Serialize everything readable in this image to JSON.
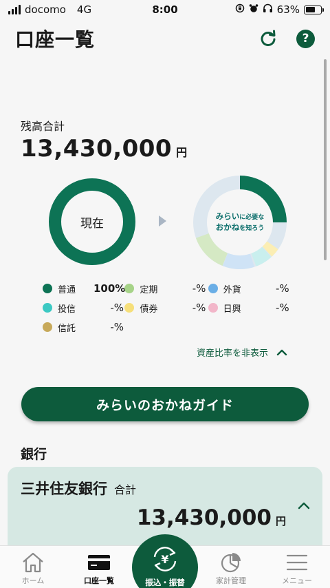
{
  "status_bar": {
    "carrier": "docomo",
    "network": "4G",
    "time": "8:00",
    "battery_pct": "63%",
    "battery_level": 0.63
  },
  "header": {
    "title": "口座一覧",
    "refresh_icon": "refresh-icon",
    "help_icon": "help-icon",
    "help_glyph": "?"
  },
  "balance": {
    "label": "残高合計",
    "amount": "13,430,000",
    "unit": "円"
  },
  "charts": {
    "current_label": "現在",
    "future_label_line1": "みらい",
    "future_label_line1_small": "に必要な",
    "future_label_line2": "おかね",
    "future_label_line2_small": "を知ろう"
  },
  "chart_data": [
    {
      "type": "pie",
      "labels": [
        "普通",
        "定期",
        "外貨",
        "投信",
        "債券",
        "日興",
        "信託"
      ],
      "values": [
        100,
        0,
        0,
        0,
        0,
        0,
        0
      ],
      "title": "現在"
    }
  ],
  "legend": [
    {
      "name": "普通",
      "pct": "100%",
      "color": "#0d7355"
    },
    {
      "name": "定期",
      "pct": "-%",
      "color": "#a6d388"
    },
    {
      "name": "外貨",
      "pct": "-%",
      "color": "#6aaee6"
    },
    {
      "name": "投信",
      "pct": "-%",
      "color": "#3cc9c3"
    },
    {
      "name": "債券",
      "pct": "-%",
      "color": "#f6df7a"
    },
    {
      "name": "日興",
      "pct": "-%",
      "color": "#f2b6c9"
    },
    {
      "name": "信託",
      "pct": "-%",
      "color": "#c7a95a"
    }
  ],
  "toggle_ratio_label": "資産比率を非表示",
  "guide_button_label": "みらいのおかねガイド",
  "bank_section": {
    "heading": "銀行",
    "bank_name": "三井住友銀行",
    "sub_label": "合計",
    "amount": "13,430,000",
    "unit": "円"
  },
  "bottom_nav": {
    "home": "ホーム",
    "accounts": "口座一覧",
    "transfer": "振込・振替",
    "transfer_glyph": "¥",
    "household": "家計管理",
    "menu": "メニュー"
  },
  "colors": {
    "brand_green": "#0d5b3c",
    "card_bg": "#d6e8e3"
  }
}
